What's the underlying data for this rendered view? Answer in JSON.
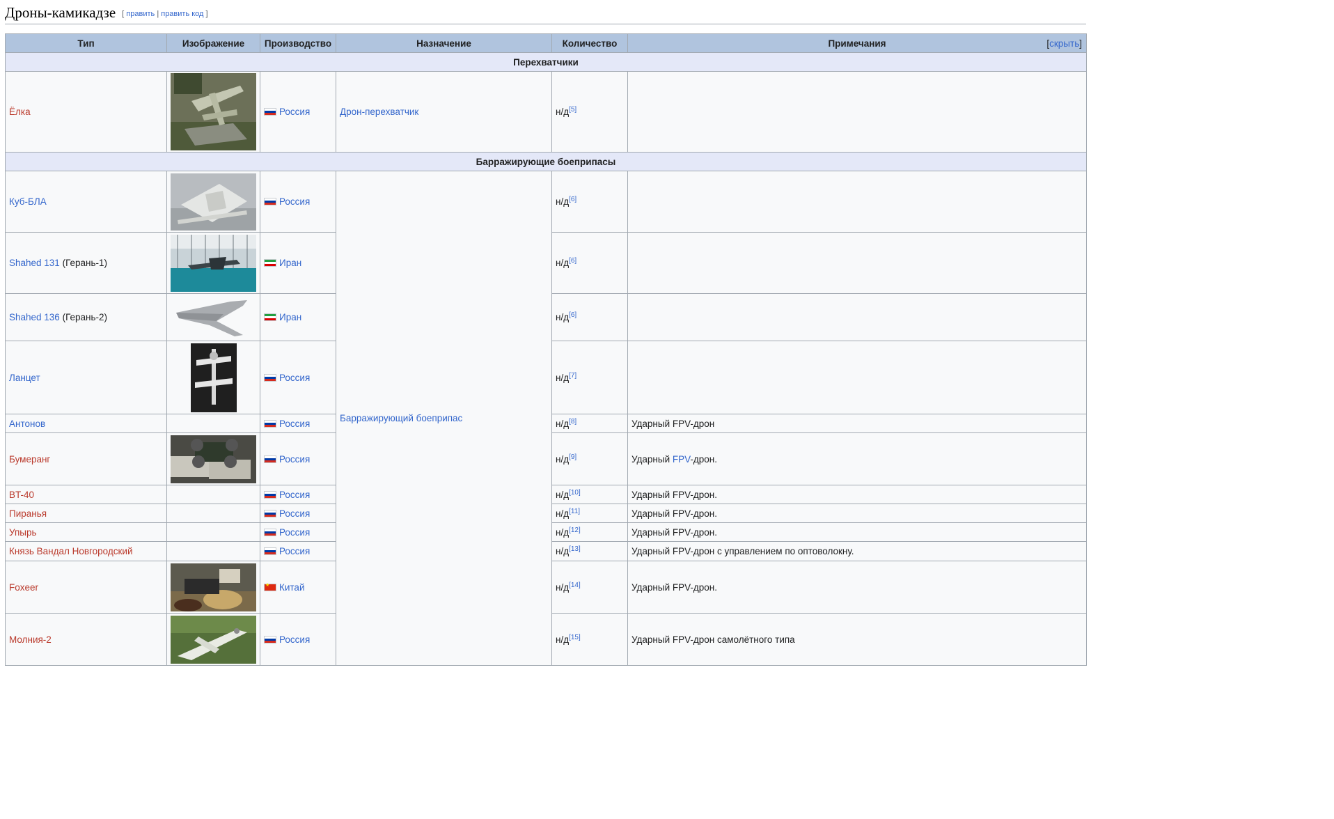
{
  "section": {
    "title": "Дроны-камикадзе",
    "edit_open": "[",
    "edit": "править",
    "separator": "|",
    "edit_code": "править код",
    "edit_close": "]"
  },
  "table": {
    "headers": [
      "Тип",
      "Изображение",
      "Производство",
      "Назначение",
      "Количество",
      "Примечания"
    ],
    "toggle": {
      "open": "[",
      "label": "скрыть",
      "close": "]"
    },
    "groups": [
      {
        "title": "Перехватчики"
      },
      {
        "title": "Барражирующие боеприпасы",
        "purpose": "Барражирующий боеприпас"
      }
    ],
    "rows": [
      {
        "type": "Ёлка",
        "type_suffix": "",
        "country": "Россия",
        "flag": "ru",
        "purpose": "Дрон-перехватчик",
        "qty": "н/д",
        "ref": "[5]",
        "notes": "",
        "image": "interceptor-drone-photo"
      },
      {
        "type": "Куб-БЛА",
        "type_suffix": "",
        "country": "Россия",
        "flag": "ru",
        "qty": "н/д",
        "ref": "[6]",
        "notes": "",
        "image": "kub-drone-photo"
      },
      {
        "type": "Shahed 131",
        "type_suffix": " (Герань-1)",
        "country": "Иран",
        "flag": "ir",
        "qty": "н/д",
        "ref": "[6]",
        "notes": "",
        "image": "shahed-131-photo"
      },
      {
        "type": "Shahed 136",
        "type_suffix": " (Герань-2)",
        "country": "Иран",
        "flag": "ir",
        "qty": "н/д",
        "ref": "[6]",
        "notes": "",
        "image": "shahed-136-photo"
      },
      {
        "type": "Ланцет",
        "type_suffix": "",
        "country": "Россия",
        "flag": "ru",
        "qty": "н/д",
        "ref": "[7]",
        "notes": "",
        "image": "lancet-photo"
      },
      {
        "type": "Антонов",
        "type_suffix": "",
        "country": "Россия",
        "flag": "ru",
        "qty": "н/д",
        "ref": "[8]",
        "notes": "Ударный FPV-дрон",
        "image": ""
      },
      {
        "type": "Бумеранг",
        "type_suffix": "",
        "country": "Россия",
        "flag": "ru",
        "qty": "н/д",
        "ref": "[9]",
        "notes_pre": "Ударный ",
        "notes_link": "FPV",
        "notes_post": "-дрон.",
        "image": "boomerang-photo"
      },
      {
        "type": "BT-40",
        "type_suffix": "",
        "country": "Россия",
        "flag": "ru",
        "qty": "н/д",
        "ref": "[10]",
        "notes": "Ударный FPV-дрон.",
        "image": ""
      },
      {
        "type": "Пиранья",
        "type_suffix": "",
        "country": "Россия",
        "flag": "ru",
        "qty": "н/д",
        "ref": "[11]",
        "notes": "Ударный FPV-дрон.",
        "image": ""
      },
      {
        "type": "Упырь",
        "type_suffix": "",
        "country": "Россия",
        "flag": "ru",
        "qty": "н/д",
        "ref": "[12]",
        "notes": "Ударный FPV-дрон.",
        "image": ""
      },
      {
        "type": "Князь Вандал Новгородский",
        "type_suffix": "",
        "country": "Россия",
        "flag": "ru",
        "qty": "н/д",
        "ref": "[13]",
        "notes": "Ударный FPV-дрон с управлением по оптоволокну.",
        "image": ""
      },
      {
        "type": "Foxeer",
        "type_suffix": "",
        "country": "Китай",
        "flag": "cn",
        "qty": "н/д",
        "ref": "[14]",
        "notes": "Ударный FPV-дрон.",
        "image": "foxeer-photo"
      },
      {
        "type": "Молния-2",
        "type_suffix": "",
        "country": "Россия",
        "flag": "ru",
        "qty": "н/д",
        "ref": "[15]",
        "notes": "Ударный FPV-дрон самолётного типа",
        "image": "molniya-2-photo"
      }
    ]
  }
}
